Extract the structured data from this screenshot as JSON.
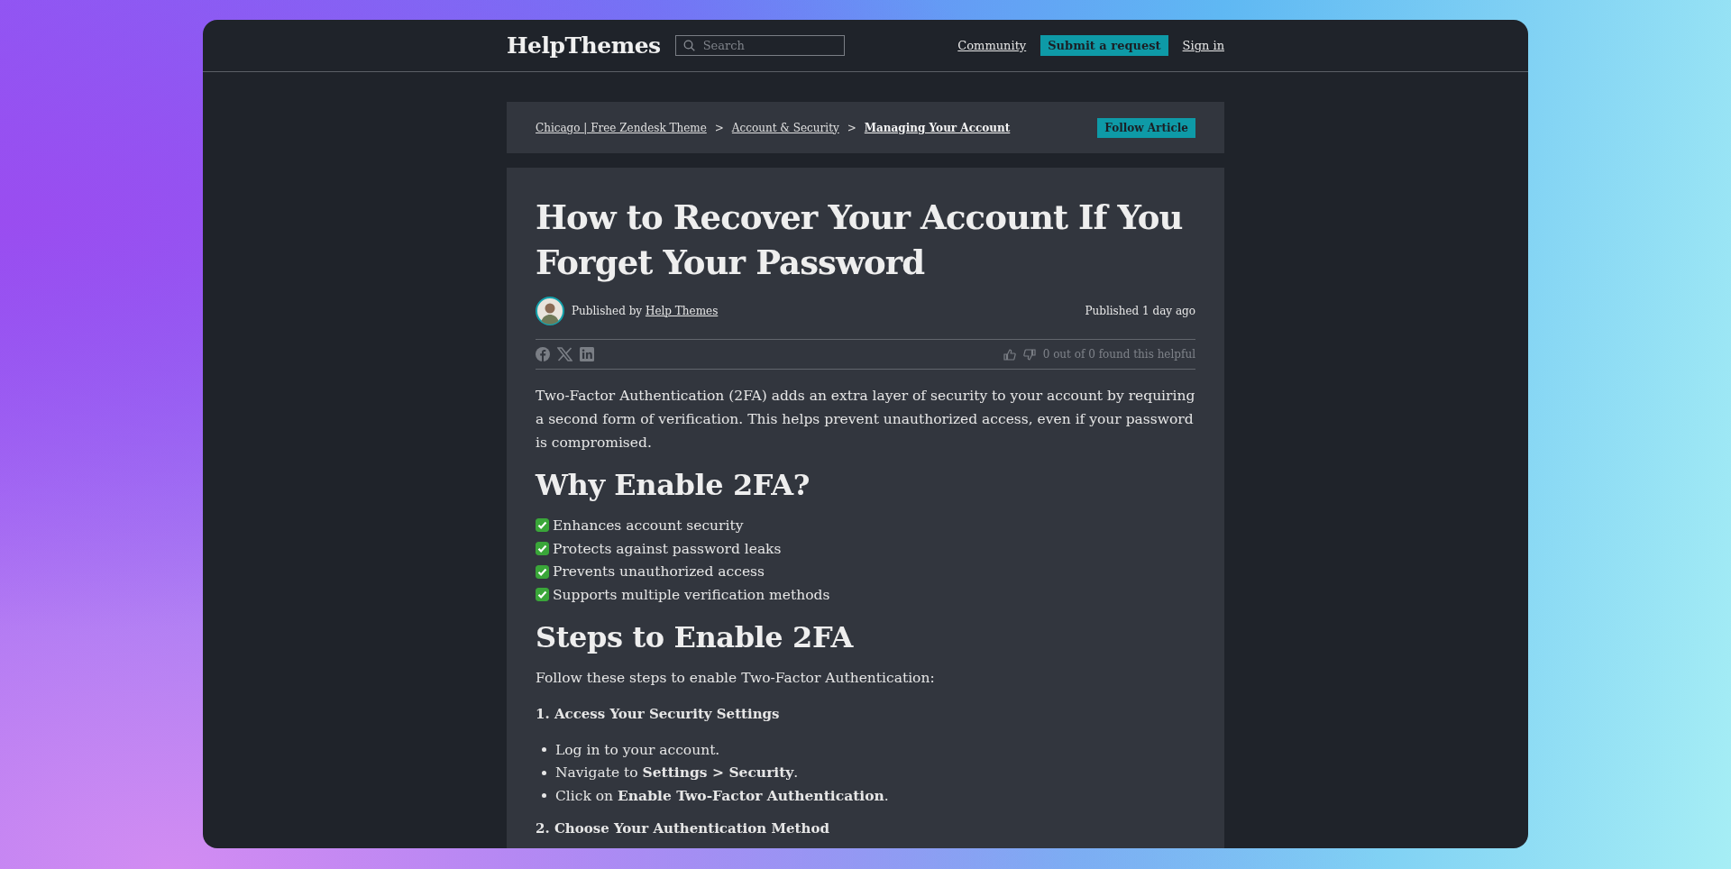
{
  "header": {
    "logo": "HelpThemes",
    "search": {
      "placeholder": "Search"
    },
    "nav": [
      {
        "kind": "link",
        "label": "Community"
      },
      {
        "kind": "button",
        "label": "Submit a request"
      },
      {
        "kind": "link",
        "label": "Sign in"
      }
    ]
  },
  "breadcrumb": [
    {
      "kind": "link",
      "label": "Chicago | Free Zendesk Theme",
      "current": false
    },
    {
      "kind": "separator",
      "label": ">"
    },
    {
      "kind": "link",
      "label": "Account & Security",
      "current": false
    },
    {
      "kind": "separator",
      "label": ">"
    },
    {
      "kind": "link",
      "label": "Managing Your Account",
      "current": true
    }
  ],
  "follow_button": "Follow Article",
  "article": {
    "title": "How to Recover Your Account If You Forget Your Password",
    "author": {
      "prefix": "Published by",
      "name": "Help Themes"
    },
    "published": "Published 1 day ago",
    "helpful": "0 out of 0 found this helpful",
    "content": [
      {
        "kind": "paragraph",
        "text": "Two-Factor Authentication (2FA) adds an extra layer of security to your account by requiring a second form of verification. This helps prevent unauthorized access, even if your password is compromised."
      },
      {
        "kind": "heading",
        "text": "Why Enable 2FA?"
      },
      {
        "kind": "checklist",
        "items": [
          {
            "text": "Enhances account security",
            "checked": true
          },
          {
            "text": "Protects against password leaks",
            "checked": true
          },
          {
            "text": "Prevents unauthorized access",
            "checked": true
          },
          {
            "text": "Supports multiple verification methods",
            "checked": true
          }
        ]
      },
      {
        "kind": "heading",
        "text": "Steps to Enable 2FA"
      },
      {
        "kind": "paragraph",
        "text": "Follow these steps to enable Two-Factor Authentication:"
      },
      {
        "kind": "step",
        "text": "1. Access Your Security Settings"
      },
      {
        "kind": "bullets",
        "items": [
          "Log in to your account.",
          "Navigate to **Settings > Security**.",
          "Click on **Enable Two-Factor Authentication**."
        ]
      },
      {
        "kind": "step",
        "text": "2. Choose Your Authentication Method"
      }
    ]
  }
}
